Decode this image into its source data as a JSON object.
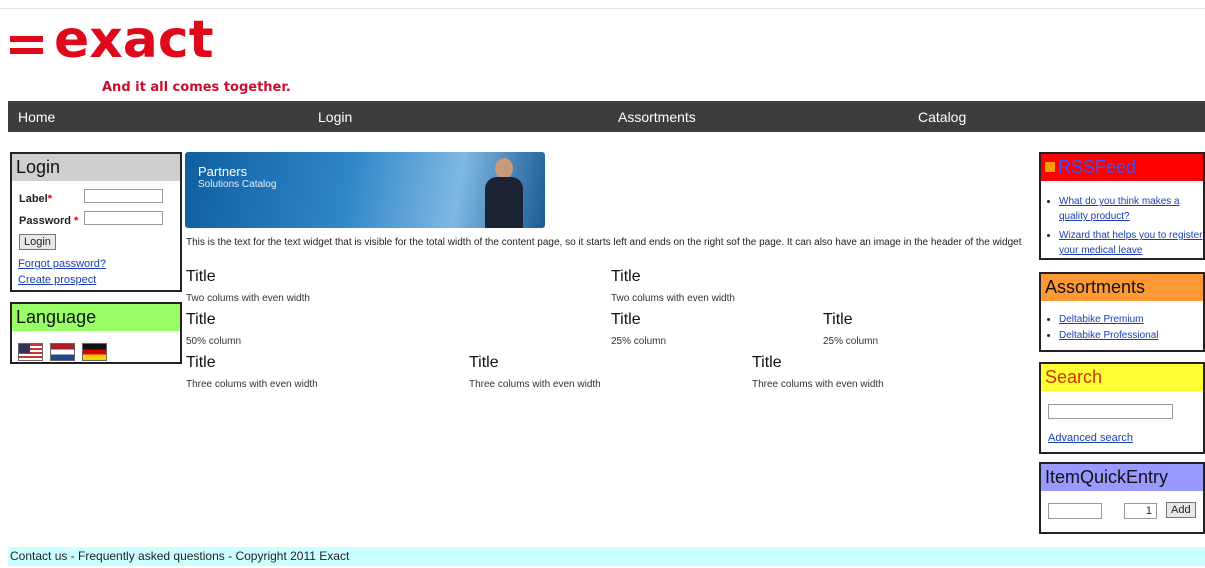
{
  "header": {
    "logo_word": "exact",
    "tagline": "And it all comes together."
  },
  "nav": {
    "items": [
      {
        "label": "Home"
      },
      {
        "label": "Login"
      },
      {
        "label": "Assortments"
      },
      {
        "label": "Catalog"
      }
    ]
  },
  "login": {
    "title": "Login",
    "label_field": "Label",
    "password_field": "Password",
    "required_mark": "*",
    "button": "Login",
    "forgot": "Forgot password?",
    "create": "Create prospect"
  },
  "language": {
    "title": "Language",
    "flags": [
      "us-flag-icon",
      "nl-flag-icon",
      "de-flag-icon"
    ]
  },
  "banner": {
    "line1": "Partners",
    "line2": "Solutions Catalog"
  },
  "content": {
    "text": "This is the text for the text widget that is visible for the total width of the content page, so it starts left and ends on the right sof the page. It can also have an image in the header of the widget",
    "rows": [
      [
        {
          "title": "Title",
          "sub": "Two colums with even width"
        },
        {
          "title": "Title",
          "sub": "Two colums with even width"
        }
      ],
      [
        {
          "title": "Title",
          "sub": "50% column"
        },
        {
          "title": "Title",
          "sub": "25% column"
        },
        {
          "title": "Title",
          "sub": "25% column"
        }
      ],
      [
        {
          "title": "Title",
          "sub": "Three colums with even width"
        },
        {
          "title": "Title",
          "sub": "Three colums with even width"
        },
        {
          "title": "Title",
          "sub": "Three colums with even width"
        }
      ]
    ]
  },
  "rss": {
    "title": "RSSFeed",
    "items": [
      "What do you think makes a quality product?",
      "Wizard that helps you to register your medical leave"
    ]
  },
  "assortments": {
    "title": "Assortments",
    "items": [
      "Deltabike Premium",
      "Deltabike Professional"
    ]
  },
  "search": {
    "title": "Search",
    "advanced": "Advanced search"
  },
  "quick_entry": {
    "title": "ItemQuickEntry",
    "quantity": "1",
    "button": "Add"
  },
  "footer": {
    "text": "Contact us - Frequently asked questions - Copyright 2011 Exact"
  },
  "colors": {
    "brand_red": "#e0091b",
    "nav_bg": "#3d3d3d",
    "login_head": "#cfcfcf",
    "language_head": "#99ff66",
    "rss_head": "#ff0000",
    "assortments_head": "#ff9933",
    "search_head": "#ffff33",
    "quick_entry_head": "#9999ff",
    "footer_bg": "#ccffff",
    "link": "#1a3fb3"
  }
}
